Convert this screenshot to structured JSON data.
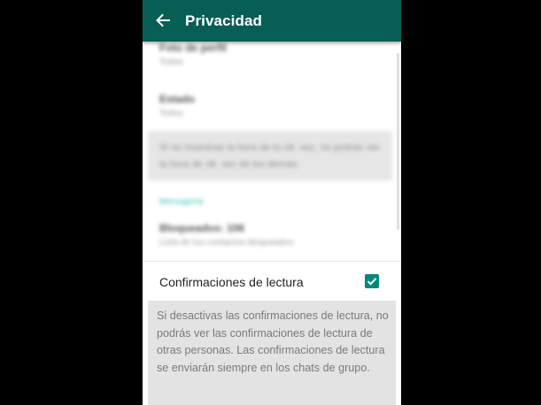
{
  "app_bar": {
    "title": "Privacidad",
    "back_icon": "arrow-left-icon",
    "color": "#075e54"
  },
  "blurred_items": [
    {
      "title": "Foto de perfil",
      "subtitle": "Todos"
    },
    {
      "title": "Estado",
      "subtitle": "Todos"
    }
  ],
  "blurred_note": "Si no muestras la hora de tu últ. vez, no podrás ver la hora de últ. vez de los demás.",
  "blurred_section": "Mensajería",
  "blurred_blocked": {
    "title": "Bloqueados: 106",
    "subtitle": "Lista de tus contactos bloqueados"
  },
  "read_receipts": {
    "label": "Confirmaciones de lectura",
    "checked": true,
    "checkbox_color": "#00897b"
  },
  "info": {
    "text": "Si desactivas las confirmaciones de lectura, no podrás ver las confirmaciones de lectura de otras personas. Las confirmaciones de lectura se enviarán siempre en los chats de grupo."
  }
}
